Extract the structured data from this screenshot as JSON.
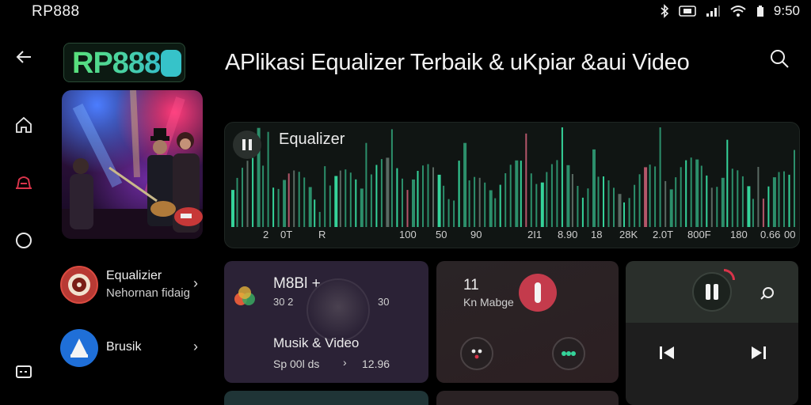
{
  "status_bar": {
    "app_name": "RP888",
    "time": "9:50"
  },
  "logo": {
    "text": "RP888"
  },
  "page": {
    "title": "APlikasi Equalizer Terbaik & uKpiar &aui Video"
  },
  "equalizer": {
    "label": "Equalizer",
    "frequencies": [
      "2",
      "0T",
      "R",
      "100",
      "50",
      "90",
      "2I1",
      "8.90",
      "18",
      "28K",
      "2.0T",
      "800F",
      "180",
      "0.66",
      "00"
    ],
    "colors": {
      "bright": "#35d39a",
      "mid": "#2c8f6b",
      "dim": "#5a6a63",
      "accent": "#b4566a"
    }
  },
  "side_list": [
    {
      "title": "Equalizier",
      "subtitle": "Nehornan fidaig",
      "icon": "equalizer-disc-icon",
      "color": "#c0392b"
    },
    {
      "title": "Brusik",
      "subtitle": "",
      "icon": "music-triangle-icon",
      "color": "#1f6fd8"
    }
  ],
  "cards": {
    "music": {
      "title": "M8Bl +",
      "left_value": "30 2",
      "right_value": "30",
      "name": "Musik & Video",
      "meta_left": "Sp 00l ds",
      "meta_right": "12.96"
    },
    "knob": {
      "number": "11",
      "label": "Kn Mabge"
    }
  },
  "colors": {
    "accent_red": "#d9344a",
    "accent_green": "#35d39a",
    "bg": "#000000"
  }
}
